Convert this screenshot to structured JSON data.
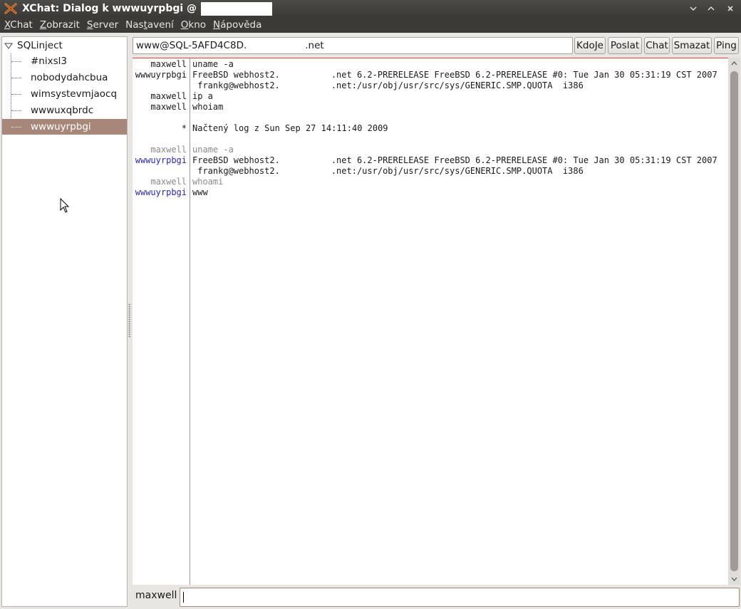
{
  "window": {
    "title": "XChat: Dialog k wwwuyrpbgi @",
    "controls": [
      "minimize",
      "maximize",
      "close"
    ]
  },
  "menu": {
    "items": [
      {
        "u": "X",
        "rest": "Chat"
      },
      {
        "pre": "",
        "u": "Z",
        "rest": "obrazit"
      },
      {
        "pre": "",
        "u": "S",
        "rest": "erver"
      },
      {
        "pre": "Nas",
        "u": "t",
        "rest": "avení"
      },
      {
        "pre": "",
        "u": "O",
        "rest": "kno"
      },
      {
        "pre": "",
        "u": "N",
        "rest": "ápověda"
      }
    ]
  },
  "tree": {
    "root": "SQLinject",
    "children": [
      "#nixsl3",
      "nobodydahcbua",
      "wimsystevmjaocq",
      "wwwuxqbrdc",
      "wwwuyrpbgi"
    ],
    "selected_index": 4
  },
  "topic": {
    "prefix": "www@SQL-5AFD4C8D.",
    "suffix": ".net"
  },
  "buttons": [
    "KdoJe",
    "Poslat",
    "Chat",
    "Smazat",
    "Ping"
  ],
  "chat": {
    "lines": [
      {
        "nick": "maxwell",
        "style": "old",
        "msg": "uname -a"
      },
      {
        "nick": "wwwuyrpbgi",
        "style": "old",
        "msg_a": "FreeBSD webhost2.",
        "msg_b": ".net 6.2-PRERELEASE FreeBSD 6.2-PRERELEASE #0: Tue Jan 30 05:31:19 CST 2007"
      },
      {
        "nick": "",
        "style": "old",
        "msg_a": " frankg@webhost2.",
        "msg_b": ".net:/usr/obj/usr/src/sys/GENERIC.SMP.QUOTA  i386"
      },
      {
        "nick": "maxwell",
        "style": "old",
        "msg": "ip a"
      },
      {
        "nick": "maxwell",
        "style": "old",
        "msg": "whoiam"
      },
      {
        "nick": "*",
        "style": "old",
        "msg": "Načtený log z Sun Sep 27 14:11:40 2009"
      },
      {
        "nick": "maxwell",
        "style": "grey",
        "msg": "uname -a"
      },
      {
        "nick": "wwwuyrpbgi",
        "style": "blue",
        "msg_a": "FreeBSD webhost2.",
        "msg_b": ".net 6.2-PRERELEASE FreeBSD 6.2-PRERELEASE #0: Tue Jan 30 05:31:19 CST 2007"
      },
      {
        "nick": "",
        "style": "blue",
        "msg_a": " frankg@webhost2.",
        "msg_b": ".net:/usr/obj/usr/src/sys/GENERIC.SMP.QUOTA  i386"
      },
      {
        "nick": "maxwell",
        "style": "grey",
        "msg": "whoami"
      },
      {
        "nick": "wwwuyrpbgi",
        "style": "blue",
        "msg": "www"
      }
    ]
  },
  "input": {
    "nick": "maxwell",
    "value": ""
  },
  "colors": {
    "titlebar": "#3b3a37",
    "selection": "#a7877a",
    "nick_blue": "#2a2ab0",
    "marker_red": "#d44"
  }
}
